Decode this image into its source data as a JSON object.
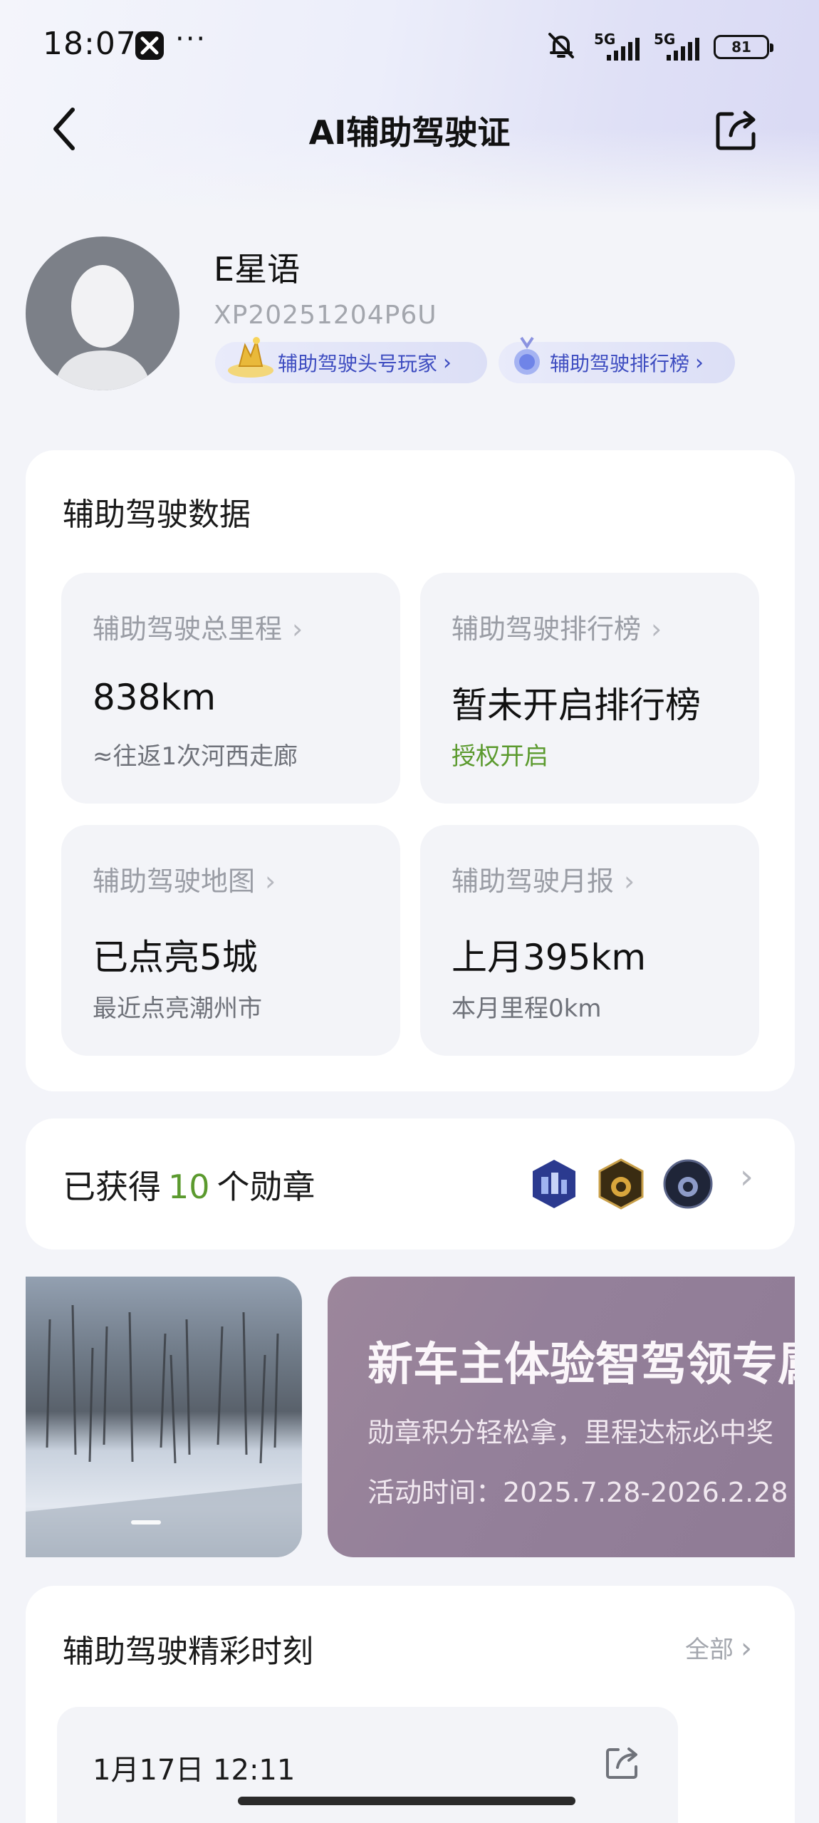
{
  "status_bar": {
    "time": "18:07",
    "dots": "···",
    "signal_1_label": "5G",
    "signal_2_label": "5G",
    "battery": "81"
  },
  "header": {
    "title": "AI辅助驾驶证"
  },
  "profile": {
    "name": "E星语",
    "user_id": "XP20251204P6U",
    "pill_1": "辅助驾驶头号玩家",
    "pill_2": "辅助驾驶排行榜"
  },
  "data_card": {
    "title": "辅助驾驶数据",
    "tiles": [
      {
        "label": "辅助驾驶总里程",
        "value": "838km",
        "sub": "≈往返1次河西走廊"
      },
      {
        "label": "辅助驾驶排行榜",
        "value": "暂未开启排行榜",
        "sub": "授权开启"
      },
      {
        "label": "辅助驾驶地图",
        "value": "已点亮5城",
        "sub": "最近点亮潮州市"
      },
      {
        "label": "辅助驾驶月报",
        "value": "上月395km",
        "sub": "本月里程0km"
      }
    ]
  },
  "badges": {
    "prefix": "已获得",
    "count": "10",
    "suffix": "个勋章"
  },
  "banner": {
    "title": "新车主体验智驾领专属",
    "subtitle": "勋章积分轻松拿，里程达标必中奖",
    "date": "活动时间：2025.7.28-2026.2.28"
  },
  "moments": {
    "title": "辅助驾驶精彩时刻",
    "all_label": "全部",
    "item_time": "1月17日 12:11"
  },
  "colors": {
    "accent_green": "#5b9a2e",
    "pill_text": "#3d4cc0",
    "background": "#f3f4f9"
  }
}
